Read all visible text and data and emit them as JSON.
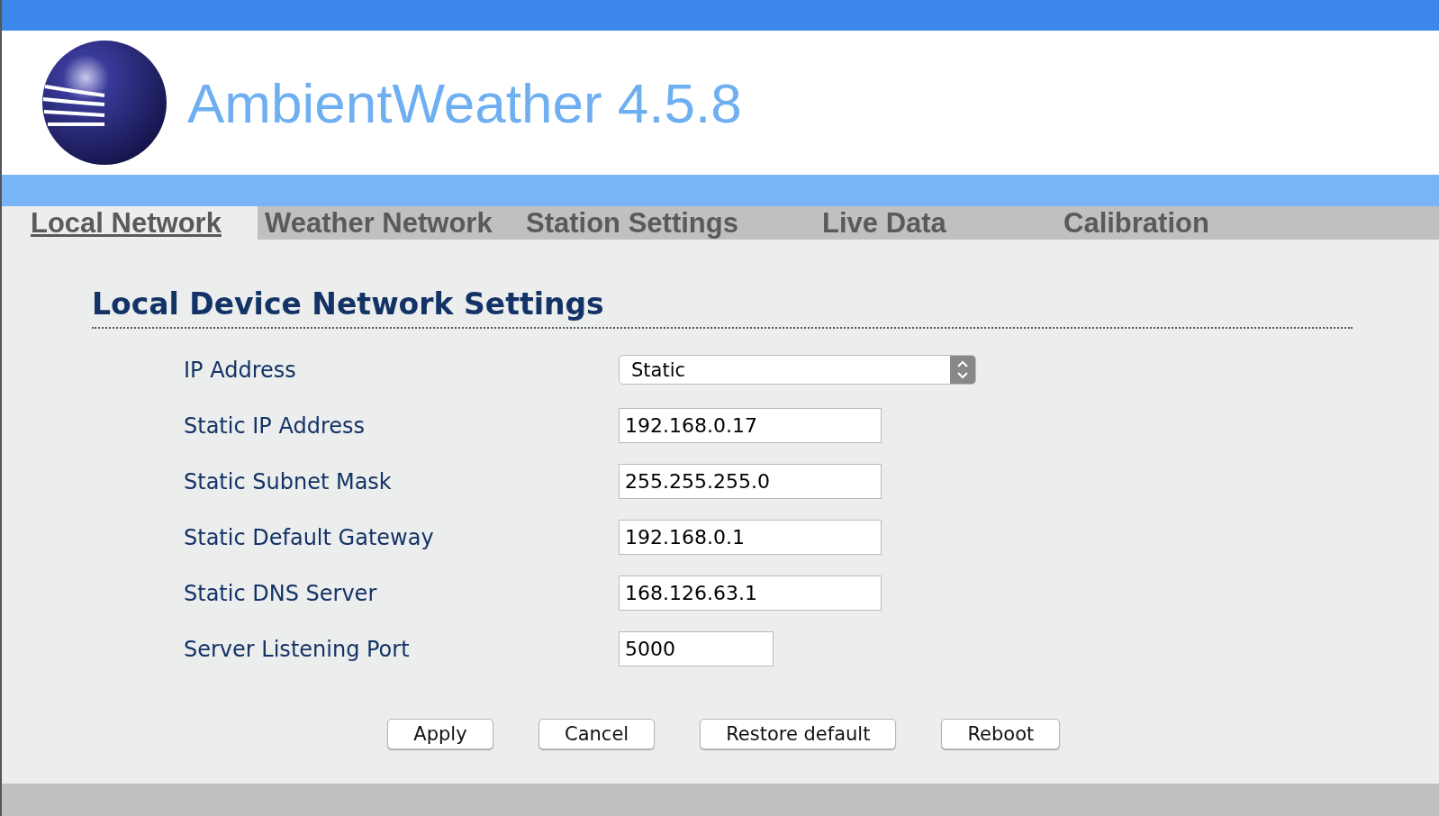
{
  "header": {
    "title": "AmbientWeather 4.5.8"
  },
  "tabs": [
    {
      "label": "Local Network",
      "selected": true
    },
    {
      "label": "Weather Network",
      "selected": false
    },
    {
      "label": "Station Settings",
      "selected": false
    },
    {
      "label": "Live Data",
      "selected": false
    },
    {
      "label": "Calibration",
      "selected": false
    }
  ],
  "section": {
    "title": "Local Device Network Settings"
  },
  "fields": [
    {
      "label": "IP Address",
      "kind": "select",
      "value": "Static"
    },
    {
      "label": "Static IP Address",
      "kind": "text",
      "value": "192.168.0.17"
    },
    {
      "label": "Static Subnet Mask",
      "kind": "text",
      "value": "255.255.255.0"
    },
    {
      "label": "Static Default Gateway",
      "kind": "text",
      "value": "192.168.0.1"
    },
    {
      "label": "Static DNS Server",
      "kind": "text",
      "value": "168.126.63.1"
    },
    {
      "label": "Server Listening Port",
      "kind": "number",
      "value": "5000"
    }
  ],
  "buttons": [
    "Apply",
    "Cancel",
    "Restore default",
    "Reboot"
  ]
}
